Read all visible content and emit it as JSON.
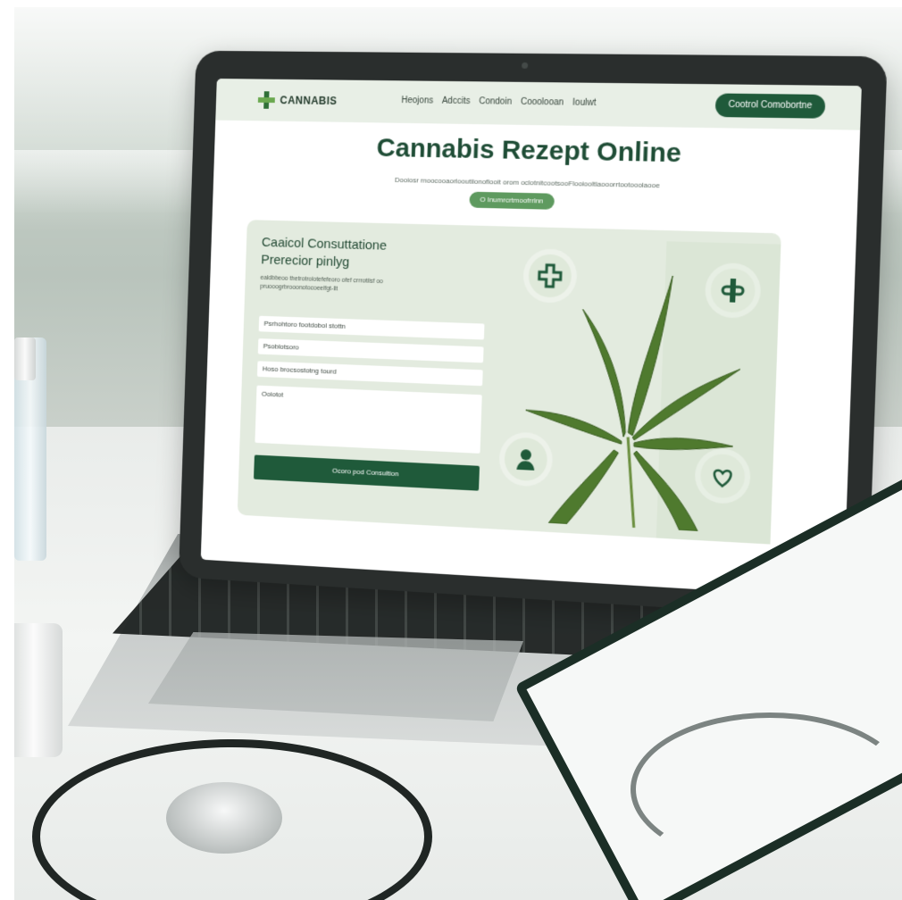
{
  "site": {
    "logo_text": "CANNABIS",
    "nav_links": [
      "Heojons",
      "Adccits",
      "Condoin",
      "Cooolooan",
      "Ioulwt"
    ],
    "nav_cta": "Cootrol Comobortne",
    "hero_title": "Cannabis Rezept Online",
    "hero_subtitle": "Dooiosr rnoocooaorlooutiionoflooit orom oclotnitcootsooFlooiooltlaooorrtootooolaooe",
    "hero_button": "O Inumrcrtmoofrrlnn",
    "card_title_line1": "Caaicol Consuttatione",
    "card_title_line2": "Prerecior pinlyg",
    "card_description": "ealdbbeoo thetrotrolotefefeoro ofef crrrotilsf oo pruooogrbrooonotocoeelfgt-llt",
    "fields": [
      "Psrhohtoro footdobol stottn",
      "Psoblotsoro",
      "Hoso brocsostotng tourd"
    ],
    "textarea_label": "Ooiotot",
    "submit_label": "Ocoro pod Consultion"
  },
  "icons": [
    "cannabis-logo-icon",
    "medical-cross-icon",
    "pharmacy-icon",
    "doctor-icon",
    "heart-dropper-icon",
    "cannabis-leaf-icon"
  ],
  "colors": {
    "brand_green": "#1f5a3a",
    "light_green": "#e3ebdf",
    "accent_green": "#5e9a5f"
  }
}
